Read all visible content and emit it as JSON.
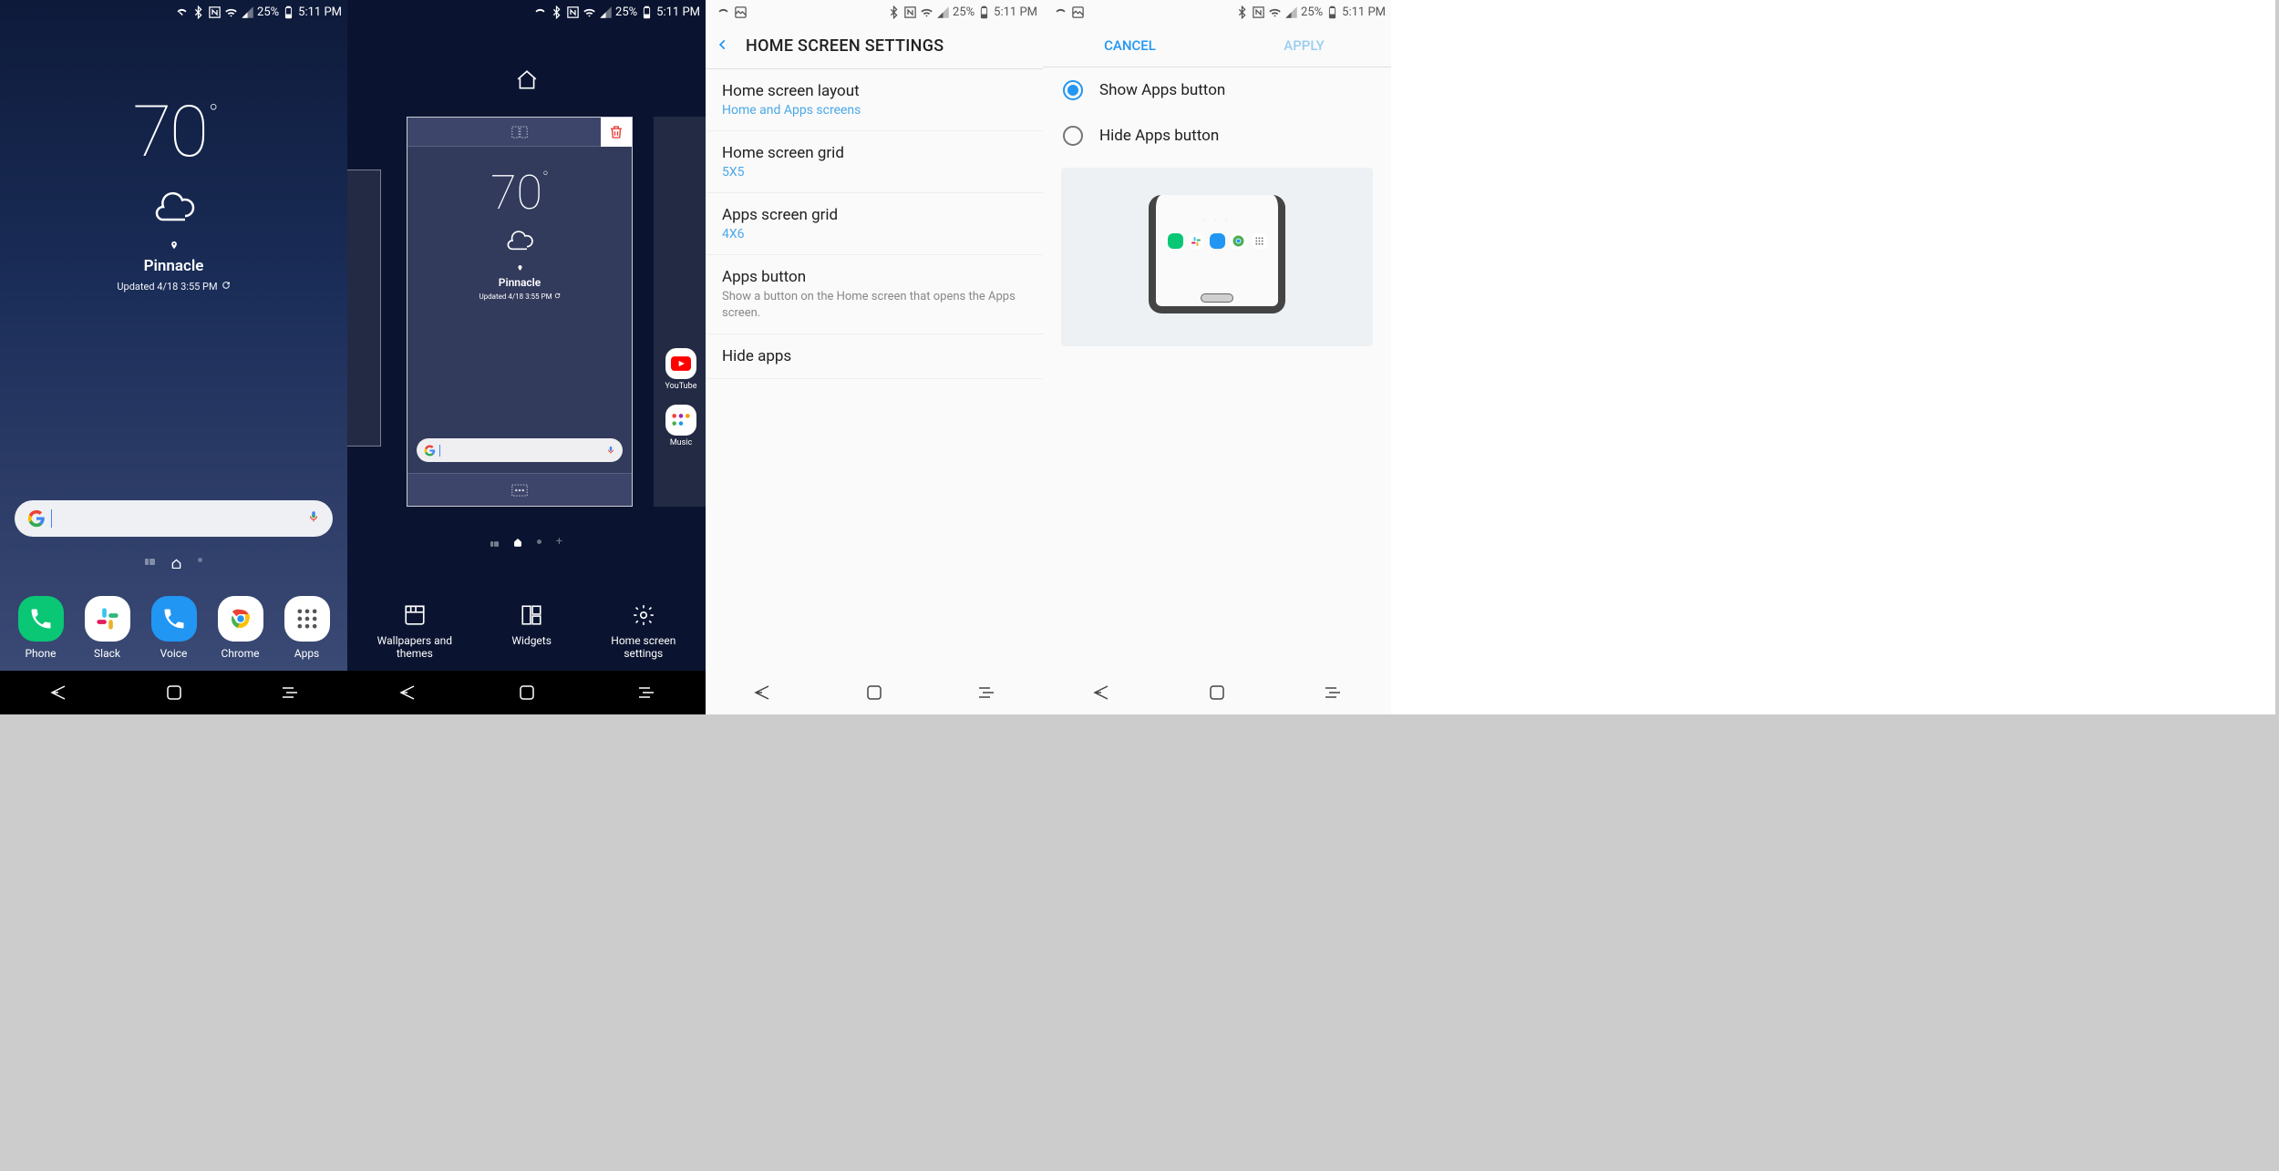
{
  "status": {
    "battery": "25%",
    "time": "5:11 PM"
  },
  "home": {
    "temp": "70",
    "location": "Pinnacle",
    "updated": "Updated 4/18 3:55 PM",
    "dock": [
      {
        "name": "Phone"
      },
      {
        "name": "Slack"
      },
      {
        "name": "Voice"
      },
      {
        "name": "Chrome"
      },
      {
        "name": "Apps"
      }
    ]
  },
  "editor": {
    "temp": "70",
    "location": "Pinnacle",
    "updated": "Updated 4/18 3:55 PM",
    "peek_apps": [
      {
        "name": "YouTube"
      },
      {
        "name": "Music"
      }
    ],
    "actions": [
      {
        "label1": "Wallpapers and",
        "label2": "themes"
      },
      {
        "label1": "Widgets",
        "label2": ""
      },
      {
        "label1": "Home screen",
        "label2": "settings"
      }
    ]
  },
  "settings": {
    "title": "HOME SCREEN SETTINGS",
    "items": [
      {
        "title": "Home screen layout",
        "value": "Home and Apps screens"
      },
      {
        "title": "Home screen grid",
        "value": "5X5"
      },
      {
        "title": "Apps screen grid",
        "value": "4X6"
      },
      {
        "title": "Apps button",
        "desc": "Show a button on the Home screen that opens the Apps screen."
      },
      {
        "title": "Hide apps"
      }
    ]
  },
  "appsbtn": {
    "cancel": "CANCEL",
    "apply": "APPLY",
    "opt1": "Show Apps button",
    "opt2": "Hide Apps button"
  }
}
